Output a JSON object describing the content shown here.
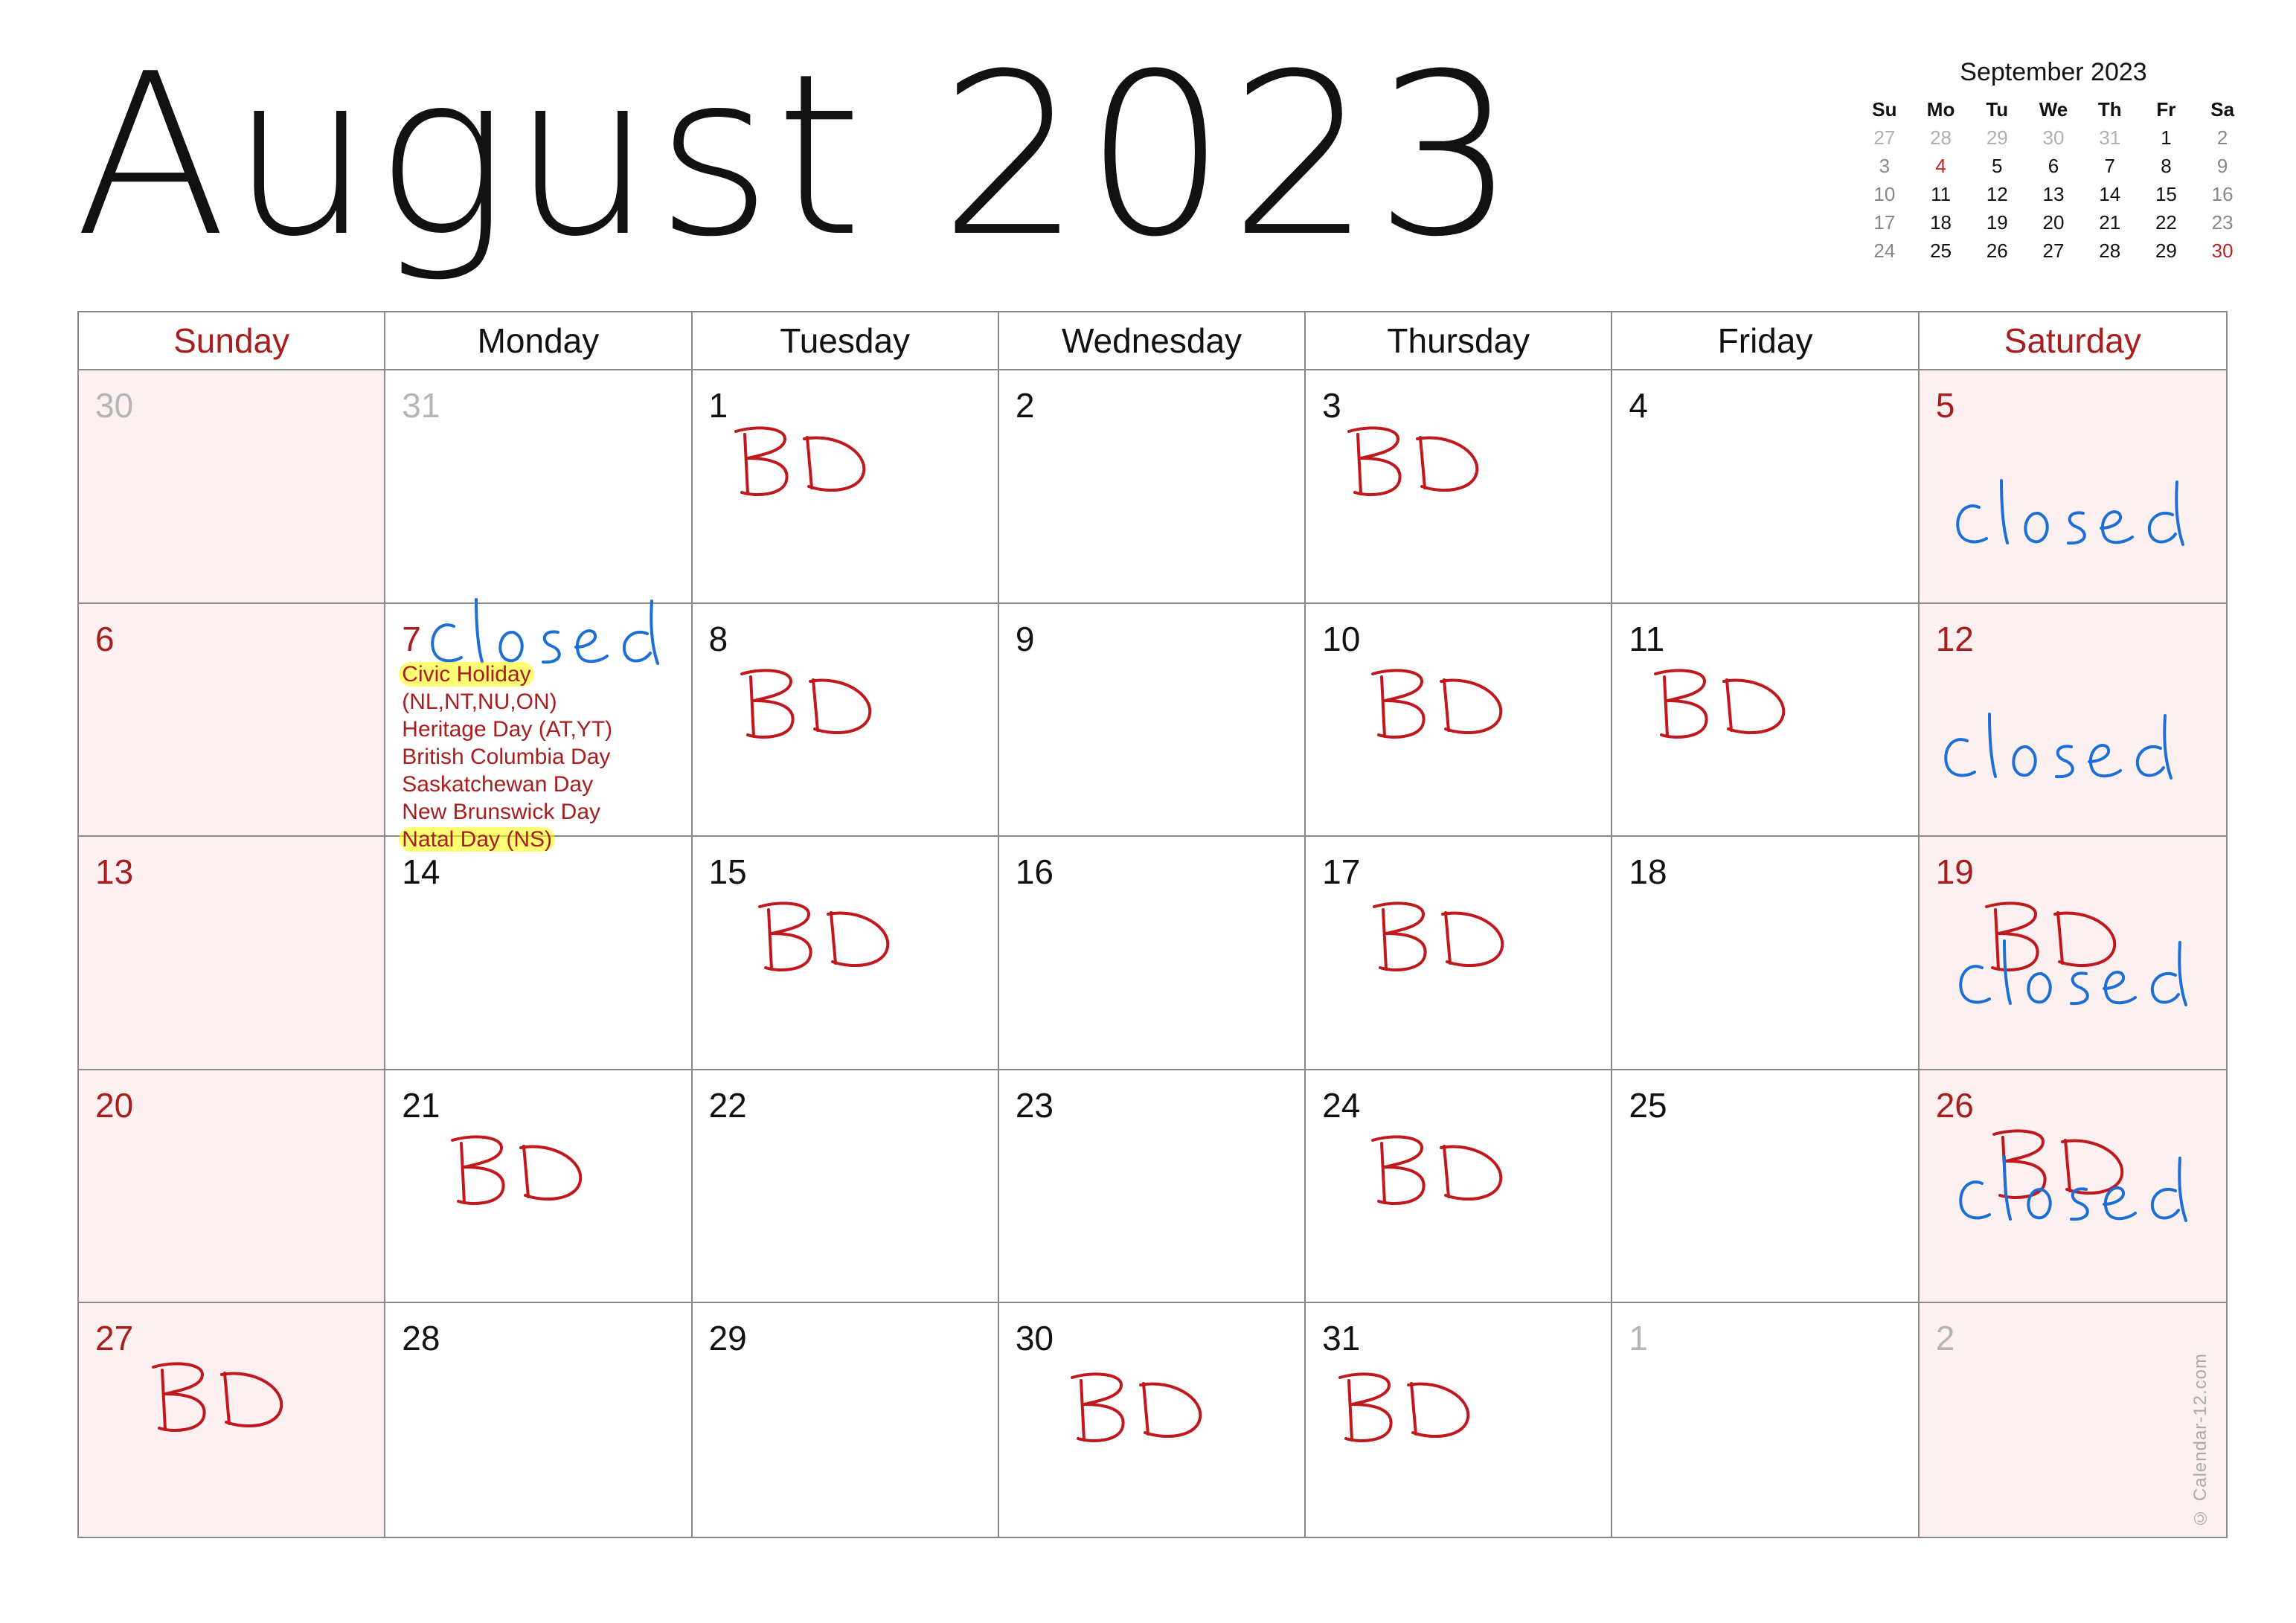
{
  "title": "August 2023",
  "mini_calendar": {
    "title": "September 2023",
    "headers": [
      "Su",
      "Mo",
      "Tu",
      "We",
      "Th",
      "Fr",
      "Sa"
    ],
    "rows": [
      [
        "27",
        "28",
        "29",
        "30",
        "31",
        "1",
        "2"
      ],
      [
        "3",
        "4",
        "5",
        "6",
        "7",
        "8",
        "9"
      ],
      [
        "10",
        "11",
        "12",
        "13",
        "14",
        "15",
        "16"
      ],
      [
        "17",
        "18",
        "19",
        "20",
        "21",
        "22",
        "23"
      ],
      [
        "24",
        "25",
        "26",
        "27",
        "28",
        "29",
        "30"
      ]
    ]
  },
  "weekdays": [
    "Sunday",
    "Monday",
    "Tuesday",
    "Wednesday",
    "Thursday",
    "Friday",
    "Saturday"
  ],
  "days": [
    "30",
    "31",
    "1",
    "2",
    "3",
    "4",
    "5",
    "6",
    "7",
    "8",
    "9",
    "10",
    "11",
    "12",
    "13",
    "14",
    "15",
    "16",
    "17",
    "18",
    "19",
    "20",
    "21",
    "22",
    "23",
    "24",
    "25",
    "26",
    "27",
    "28",
    "29",
    "30",
    "31",
    "1",
    "2"
  ],
  "holidays": [
    "Civic Holiday",
    "(NL,NT,NU,ON)",
    "Heritage Day (AT,YT)",
    "British Columbia Day",
    "Saskatchewan Day",
    "New Brunswick Day",
    "Natal Day (NS)"
  ],
  "annotations": {
    "bd": "BD",
    "closed": "closed"
  },
  "copyright": "© Calendar-12.com",
  "colors": {
    "red": "#a81d1d",
    "blue": "#1b6fd6",
    "weekend_bg": "#fdf0f0",
    "highlight": "#ffff00"
  }
}
